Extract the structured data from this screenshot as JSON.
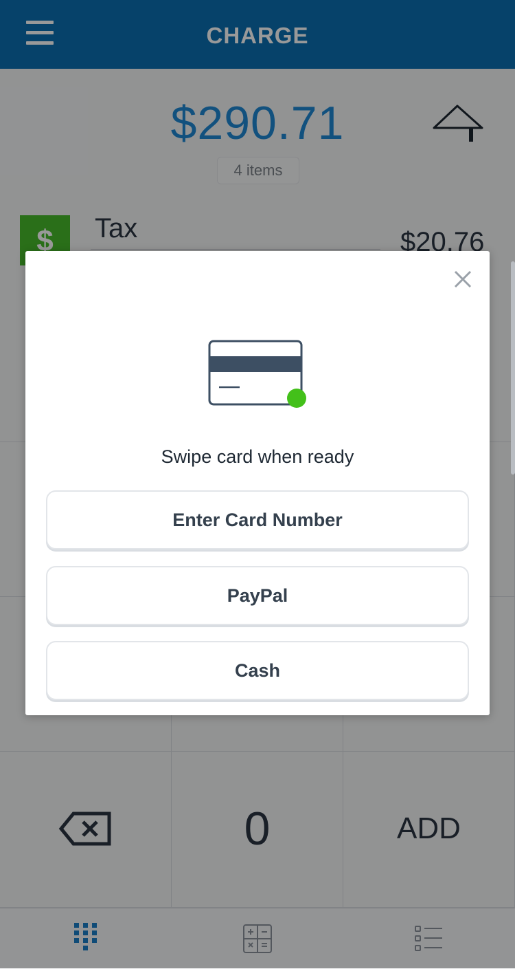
{
  "header": {
    "title": "CHARGE"
  },
  "summary": {
    "amount": "$290.71",
    "items": "4 items"
  },
  "tax": {
    "badge": "$",
    "label": "Tax",
    "value": "$20.76"
  },
  "keypad": {
    "zero": "0",
    "add": "ADD"
  },
  "modal": {
    "prompt": "Swipe card when ready",
    "options": [
      "Enter Card Number",
      "PayPal",
      "Cash"
    ]
  },
  "colors": {
    "header": "#0a6fb1",
    "amount": "#1f87d3",
    "badge": "#46b92b",
    "status_dot": "#43c01a"
  }
}
